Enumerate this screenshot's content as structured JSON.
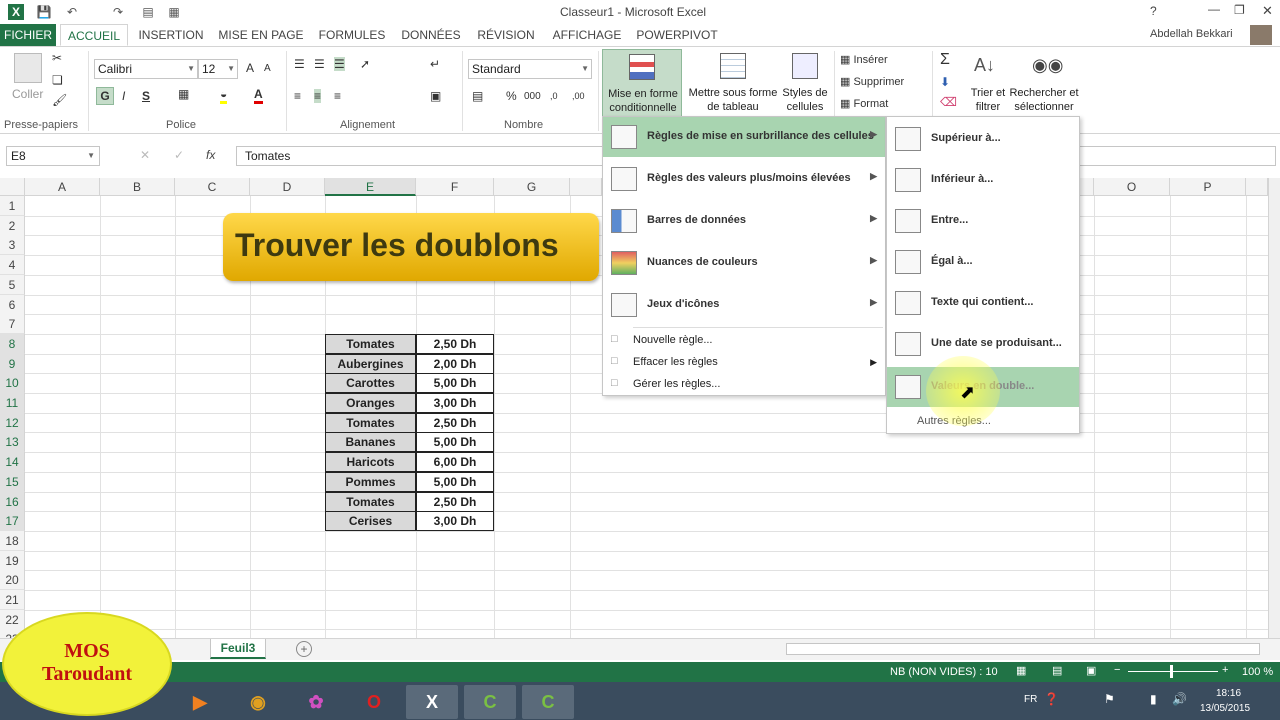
{
  "window": {
    "title": "Classeur1 - Microsoft Excel",
    "user": "Abdellah Bekkari",
    "help": "?"
  },
  "tabs": [
    "FICHIER",
    "ACCUEIL",
    "INSERTION",
    "MISE EN PAGE",
    "FORMULES",
    "DONNÉES",
    "RÉVISION",
    "AFFICHAGE",
    "POWERPIVOT"
  ],
  "ribbon": {
    "paste": "Coller",
    "clipboard": "Presse-papiers",
    "font_name": "Calibri",
    "font_size": "12",
    "bold": "G",
    "italic": "I",
    "underline": "S",
    "police": "Police",
    "alignment": "Alignement",
    "number_format": "Standard",
    "percent": "%",
    "thousands": "000",
    "nombre": "Nombre",
    "mise_en_forme_1": "Mise en forme",
    "mise_en_forme_2": "conditionnelle",
    "tableau_1": "Mettre sous forme",
    "tableau_2": "de tableau",
    "styles_1": "Styles de",
    "styles_2": "cellules",
    "inserer": "Insérer",
    "supprimer": "Supprimer",
    "format": "Format",
    "trier_1": "Trier et",
    "trier_2": "filtrer",
    "rechercher_1": "Rechercher et",
    "rechercher_2": "sélectionner"
  },
  "formula_bar": {
    "name_box": "E8",
    "value": "Tomates",
    "fx": "fx"
  },
  "columns": [
    "A",
    "B",
    "C",
    "D",
    "E",
    "F",
    "G",
    "O",
    "P"
  ],
  "rows": [
    "1",
    "2",
    "3",
    "4",
    "5",
    "6",
    "7",
    "8",
    "9",
    "10",
    "11",
    "12",
    "13",
    "14",
    "15",
    "16",
    "17",
    "18",
    "19",
    "20",
    "21",
    "22",
    "23"
  ],
  "banner": "Trouver les doublons",
  "table": [
    {
      "product": "Tomates",
      "price": "2,50 Dh"
    },
    {
      "product": "Aubergines",
      "price": "2,00 Dh"
    },
    {
      "product": "Carottes",
      "price": "5,00 Dh"
    },
    {
      "product": "Oranges",
      "price": "3,00 Dh"
    },
    {
      "product": "Tomates",
      "price": "2,50 Dh"
    },
    {
      "product": "Bananes",
      "price": "5,00 Dh"
    },
    {
      "product": "Haricots",
      "price": "6,00 Dh"
    },
    {
      "product": "Pommes",
      "price": "5,00 Dh"
    },
    {
      "product": "Tomates",
      "price": "2,50 Dh"
    },
    {
      "product": "Cerises",
      "price": "3,00 Dh"
    }
  ],
  "cf_menu": {
    "items": [
      "Règles de mise en surbrillance des cellules",
      "Règles des valeurs plus/moins élevées",
      "Barres de données",
      "Nuances de couleurs",
      "Jeux d'icônes"
    ],
    "small_items": [
      "Nouvelle règle...",
      "Effacer les règles",
      "Gérer les règles..."
    ]
  },
  "submenu": {
    "items": [
      "Supérieur à...",
      "Inférieur à...",
      "Entre...",
      "Égal à...",
      "Texte qui contient...",
      "Une date se produisant...",
      "Valeurs en double..."
    ],
    "more": "Autres règles..."
  },
  "sheet_tab": "Feuil3",
  "status": {
    "count": "NB (NON VIDES) : 10",
    "zoom": "100 %"
  },
  "watermark": {
    "line1": "MOS",
    "line2": "Taroudant"
  },
  "clock": {
    "time": "18:16",
    "date": "13/05/2015",
    "lang": "FR"
  }
}
